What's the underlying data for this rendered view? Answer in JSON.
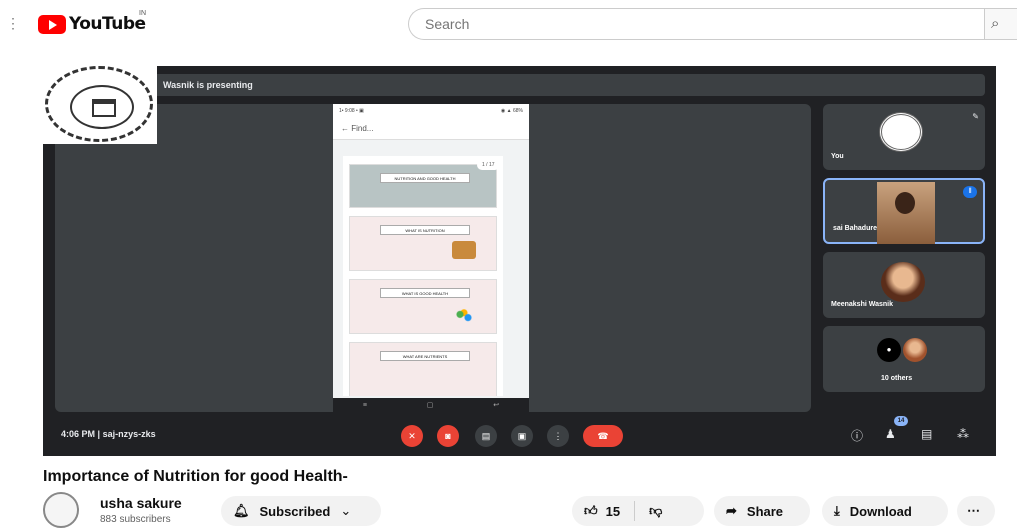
{
  "header": {
    "logo_text": "YouTube",
    "country_code": "IN",
    "search_placeholder": "Search",
    "search_button": "⌕"
  },
  "meet": {
    "presenting_banner": "Wasnik is presenting",
    "phone": {
      "status_left": "1• 9:08 • ▣",
      "status_right": "◉ ▲ 68%",
      "find_label": "←   Find...",
      "page_indicator": "1 / 17",
      "slides": [
        {
          "title": "NUTRITION AND GOOD HEALTH"
        },
        {
          "title": "WHAT IS NUTRITION"
        },
        {
          "title": "WHAT IS GOOD HEALTH"
        },
        {
          "title": "WHAT ARE NUTRIENTS"
        }
      ],
      "nav": [
        "≡",
        "▢",
        "↩"
      ]
    },
    "participants": [
      {
        "name": "You"
      },
      {
        "name": "sai Bahadure"
      },
      {
        "name": "Meenakshi Wasnik"
      },
      {
        "name": "10 others"
      }
    ],
    "meeting_time": "4:06 PM",
    "separator": "|",
    "meeting_code": "saj-nzys-zks",
    "people_count": "14"
  },
  "video": {
    "title": "Importance of Nutrition for good Health-",
    "channel_name": "usha sakure",
    "subscribers": "883 subscribers",
    "subscribe_label": "Subscribed",
    "like_count": "15",
    "share_label": "Share",
    "download_label": "Download",
    "more_label": "⋯"
  },
  "colors": {
    "brand_red": "#ff0000",
    "meet_bg": "#202124",
    "tile_bg": "#3c4043",
    "hangup_red": "#ea4335",
    "active_border": "#8ab4f8"
  }
}
